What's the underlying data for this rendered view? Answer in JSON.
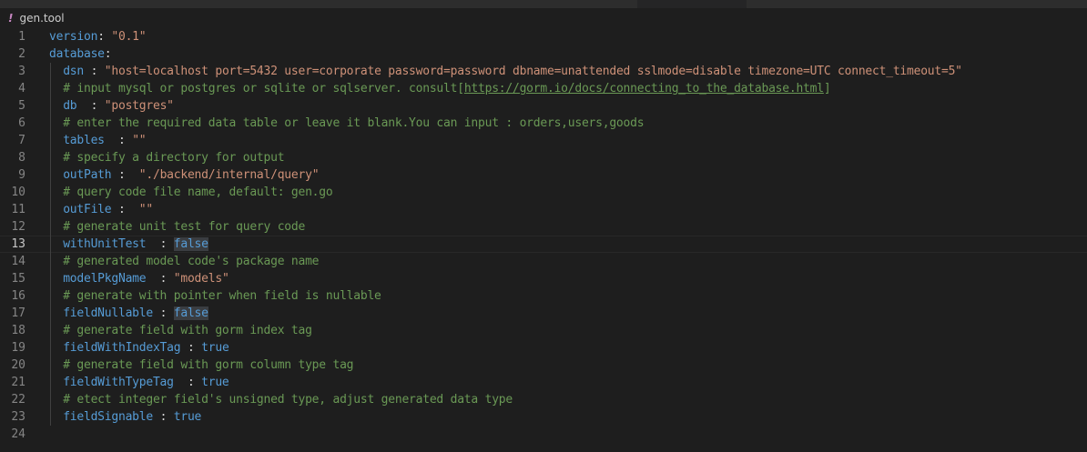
{
  "breadcrumb": {
    "icon": "yaml-exclamation-icon",
    "icon_glyph": "!",
    "file_name": "gen.tool"
  },
  "editor": {
    "current_line": 13,
    "lines": [
      {
        "n": "1",
        "indent": 0,
        "segments": [
          {
            "t": "version",
            "c": "k"
          },
          {
            "t": ": ",
            "c": "p"
          },
          {
            "t": "\"0.1\"",
            "c": "s"
          }
        ]
      },
      {
        "n": "2",
        "indent": 0,
        "segments": [
          {
            "t": "database",
            "c": "k"
          },
          {
            "t": ":",
            "c": "p"
          }
        ]
      },
      {
        "n": "3",
        "indent": 1,
        "segments": [
          {
            "t": "dsn",
            "c": "k"
          },
          {
            "t": " : ",
            "c": "p"
          },
          {
            "t": "\"host=localhost port=5432 user=corporate password=password dbname=unattended sslmode=disable timezone=UTC connect_timeout=5\"",
            "c": "s"
          }
        ]
      },
      {
        "n": "4",
        "indent": 1,
        "segments": [
          {
            "t": "# input mysql or postgres or sqlite or sqlserver. consult[",
            "c": "c"
          },
          {
            "t": "https://gorm.io/docs/connecting_to_the_database.html",
            "c": "c",
            "u": true
          },
          {
            "t": "]",
            "c": "c"
          }
        ]
      },
      {
        "n": "5",
        "indent": 1,
        "segments": [
          {
            "t": "db",
            "c": "k"
          },
          {
            "t": "  : ",
            "c": "p"
          },
          {
            "t": "\"postgres\"",
            "c": "s"
          }
        ]
      },
      {
        "n": "6",
        "indent": 1,
        "segments": [
          {
            "t": "# enter the required data table or leave it blank.You can input : orders,users,goods",
            "c": "c"
          }
        ]
      },
      {
        "n": "7",
        "indent": 1,
        "segments": [
          {
            "t": "tables",
            "c": "k"
          },
          {
            "t": "  : ",
            "c": "p"
          },
          {
            "t": "\"\"",
            "c": "s"
          }
        ]
      },
      {
        "n": "8",
        "indent": 1,
        "segments": [
          {
            "t": "# specify a directory for output",
            "c": "c"
          }
        ]
      },
      {
        "n": "9",
        "indent": 1,
        "segments": [
          {
            "t": "outPath",
            "c": "k"
          },
          {
            "t": " :  ",
            "c": "p"
          },
          {
            "t": "\"./backend/internal/query\"",
            "c": "s"
          }
        ]
      },
      {
        "n": "10",
        "indent": 1,
        "segments": [
          {
            "t": "# query code file name, default: gen.go",
            "c": "c"
          }
        ]
      },
      {
        "n": "11",
        "indent": 1,
        "segments": [
          {
            "t": "outFile",
            "c": "k"
          },
          {
            "t": " :  ",
            "c": "p"
          },
          {
            "t": "\"\"",
            "c": "s"
          }
        ]
      },
      {
        "n": "12",
        "indent": 1,
        "segments": [
          {
            "t": "# generate unit test for query code",
            "c": "c"
          }
        ]
      },
      {
        "n": "13",
        "indent": 1,
        "segments": [
          {
            "t": "withUnitTest",
            "c": "k"
          },
          {
            "t": "  : ",
            "c": "p"
          },
          {
            "t": "false",
            "c": "b",
            "hl": true
          }
        ]
      },
      {
        "n": "14",
        "indent": 1,
        "segments": [
          {
            "t": "# generated model code's package name",
            "c": "c"
          }
        ]
      },
      {
        "n": "15",
        "indent": 1,
        "segments": [
          {
            "t": "modelPkgName",
            "c": "k"
          },
          {
            "t": "  : ",
            "c": "p"
          },
          {
            "t": "\"models\"",
            "c": "s"
          }
        ]
      },
      {
        "n": "16",
        "indent": 1,
        "segments": [
          {
            "t": "# generate with pointer when field is nullable",
            "c": "c"
          }
        ]
      },
      {
        "n": "17",
        "indent": 1,
        "segments": [
          {
            "t": "fieldNullable",
            "c": "k"
          },
          {
            "t": " : ",
            "c": "p"
          },
          {
            "t": "false",
            "c": "b",
            "hl": true
          }
        ]
      },
      {
        "n": "18",
        "indent": 1,
        "segments": [
          {
            "t": "# generate field with gorm index tag",
            "c": "c"
          }
        ]
      },
      {
        "n": "19",
        "indent": 1,
        "segments": [
          {
            "t": "fieldWithIndexTag",
            "c": "k"
          },
          {
            "t": " : ",
            "c": "p"
          },
          {
            "t": "true",
            "c": "b"
          }
        ]
      },
      {
        "n": "20",
        "indent": 1,
        "segments": [
          {
            "t": "# generate field with gorm column type tag",
            "c": "c"
          }
        ]
      },
      {
        "n": "21",
        "indent": 1,
        "segments": [
          {
            "t": "fieldWithTypeTag",
            "c": "k"
          },
          {
            "t": "  : ",
            "c": "p"
          },
          {
            "t": "true",
            "c": "b"
          }
        ]
      },
      {
        "n": "22",
        "indent": 1,
        "segments": [
          {
            "t": "# etect integer field's unsigned type, adjust generated data type",
            "c": "c"
          }
        ]
      },
      {
        "n": "23",
        "indent": 1,
        "segments": [
          {
            "t": "fieldSignable",
            "c": "k"
          },
          {
            "t": " : ",
            "c": "p"
          },
          {
            "t": "true",
            "c": "b"
          }
        ]
      },
      {
        "n": "24",
        "indent": 0,
        "segments": []
      }
    ]
  }
}
